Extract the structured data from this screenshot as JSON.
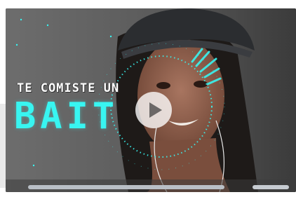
{
  "video": {
    "caption_line1": "TE COMISTE UN",
    "caption_line2": "BAIT",
    "accent_color": "#38f5f1",
    "play_icon": "play-icon",
    "progress_fraction": 0.0
  }
}
